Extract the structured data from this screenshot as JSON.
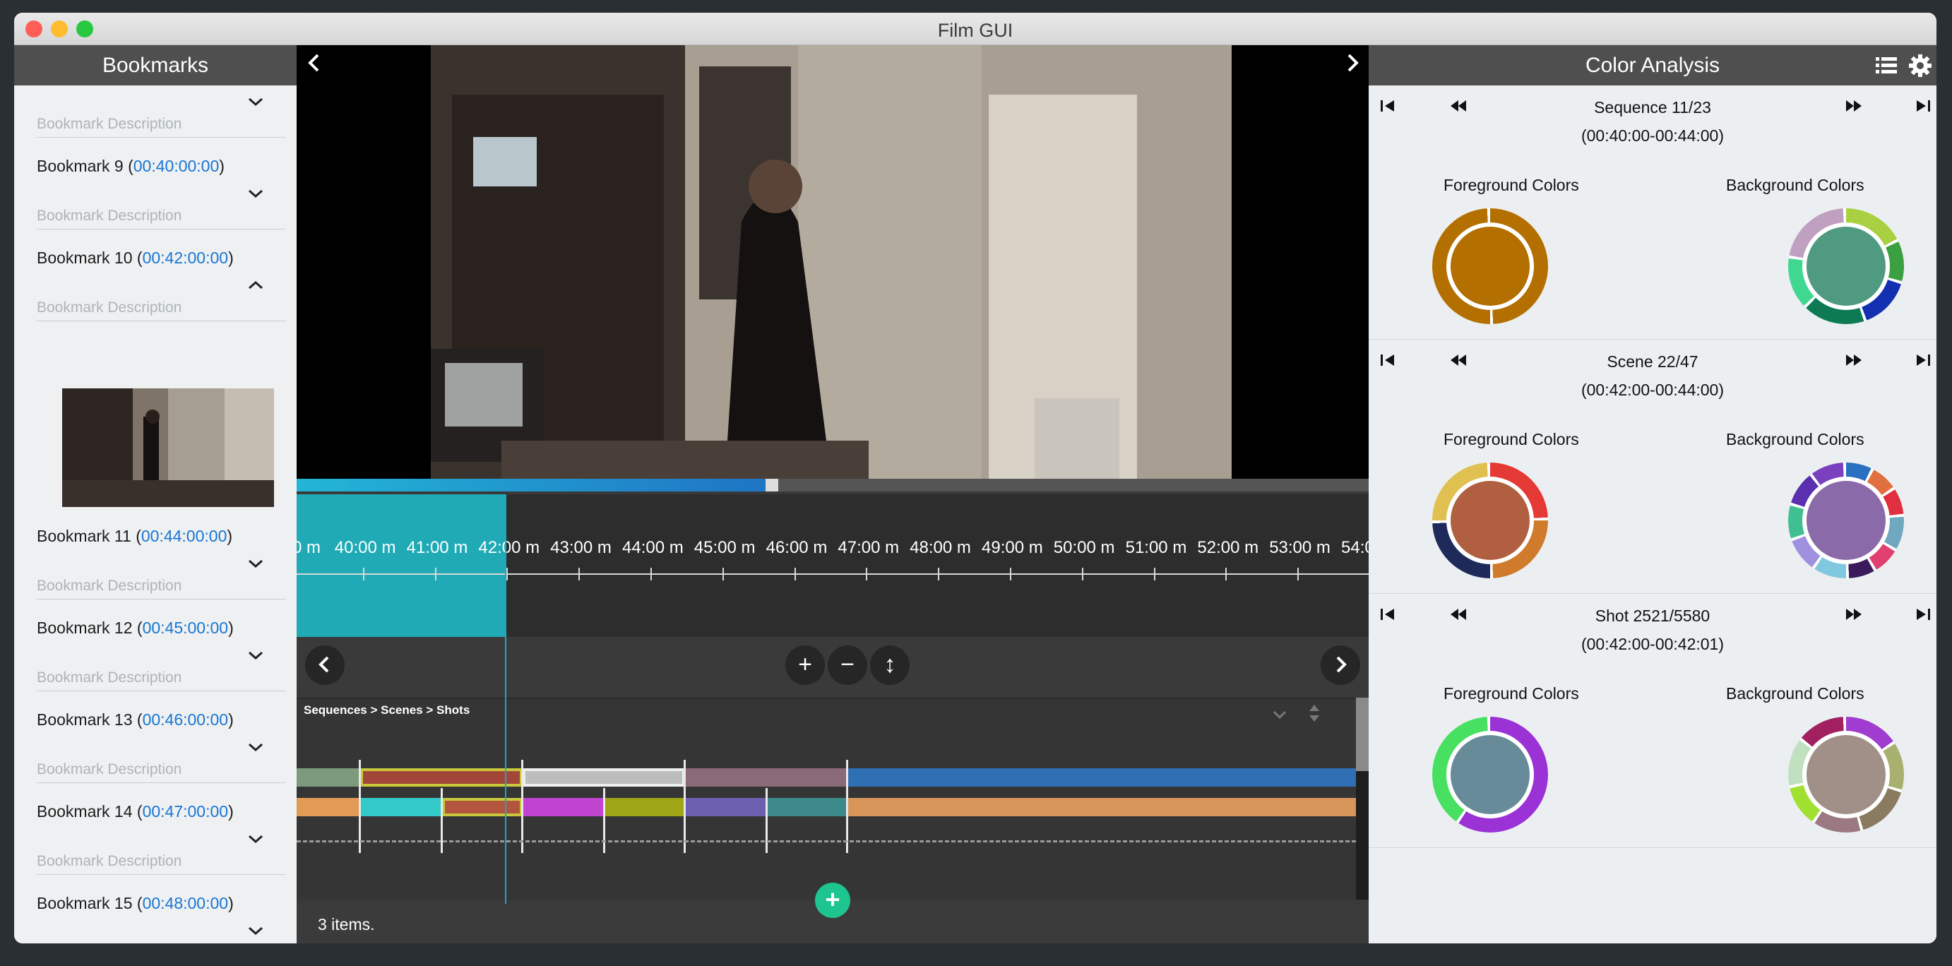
{
  "window": {
    "title": "Film GUI"
  },
  "bookmarks": {
    "header": "Bookmarks",
    "desc_placeholder": "Bookmark Description",
    "items": [
      {
        "label": "Bookmark 9 (",
        "time": "00:40:00:00",
        "close": ")"
      },
      {
        "label": "Bookmark 10 (",
        "time": "00:42:00:00",
        "close": ")"
      },
      {
        "label": "Bookmark 11 (",
        "time": "00:44:00:00",
        "close": ")"
      },
      {
        "label": "Bookmark 12 (",
        "time": "00:45:00:00",
        "close": ")"
      },
      {
        "label": "Bookmark 13 (",
        "time": "00:46:00:00",
        "close": ")"
      },
      {
        "label": "Bookmark 14 (",
        "time": "00:47:00:00",
        "close": ")"
      },
      {
        "label": "Bookmark 15 (",
        "time": "00:48:00:00",
        "close": ")"
      }
    ]
  },
  "player": {
    "progress": 0.44,
    "ticks": [
      "0 m",
      "40:00 m",
      "41:00 m",
      "42:00 m",
      "43:00 m",
      "44:00 m",
      "45:00 m",
      "46:00 m",
      "47:00 m",
      "48:00 m",
      "49:00 m",
      "50:00 m",
      "51:00 m",
      "52:00 m",
      "53:00 m",
      "54:0"
    ],
    "breadcrumb": "Sequences > Scenes > Shots",
    "footer": "3 items."
  },
  "color_analysis": {
    "header": "Color Analysis",
    "fg_label": "Foreground Colors",
    "bg_label": "Background Colors",
    "sections": [
      {
        "title": "Sequence 11/23",
        "range": "(00:40:00-00:44:00)"
      },
      {
        "title": "Scene 22/47",
        "range": "(00:42:00-00:44:00)"
      },
      {
        "title": "Shot 2521/5580",
        "range": "(00:42:00-00:42:01)"
      }
    ]
  },
  "colors": {
    "accent": "#1976d2",
    "teal": "#20aab5",
    "add": "#1ec58e"
  }
}
